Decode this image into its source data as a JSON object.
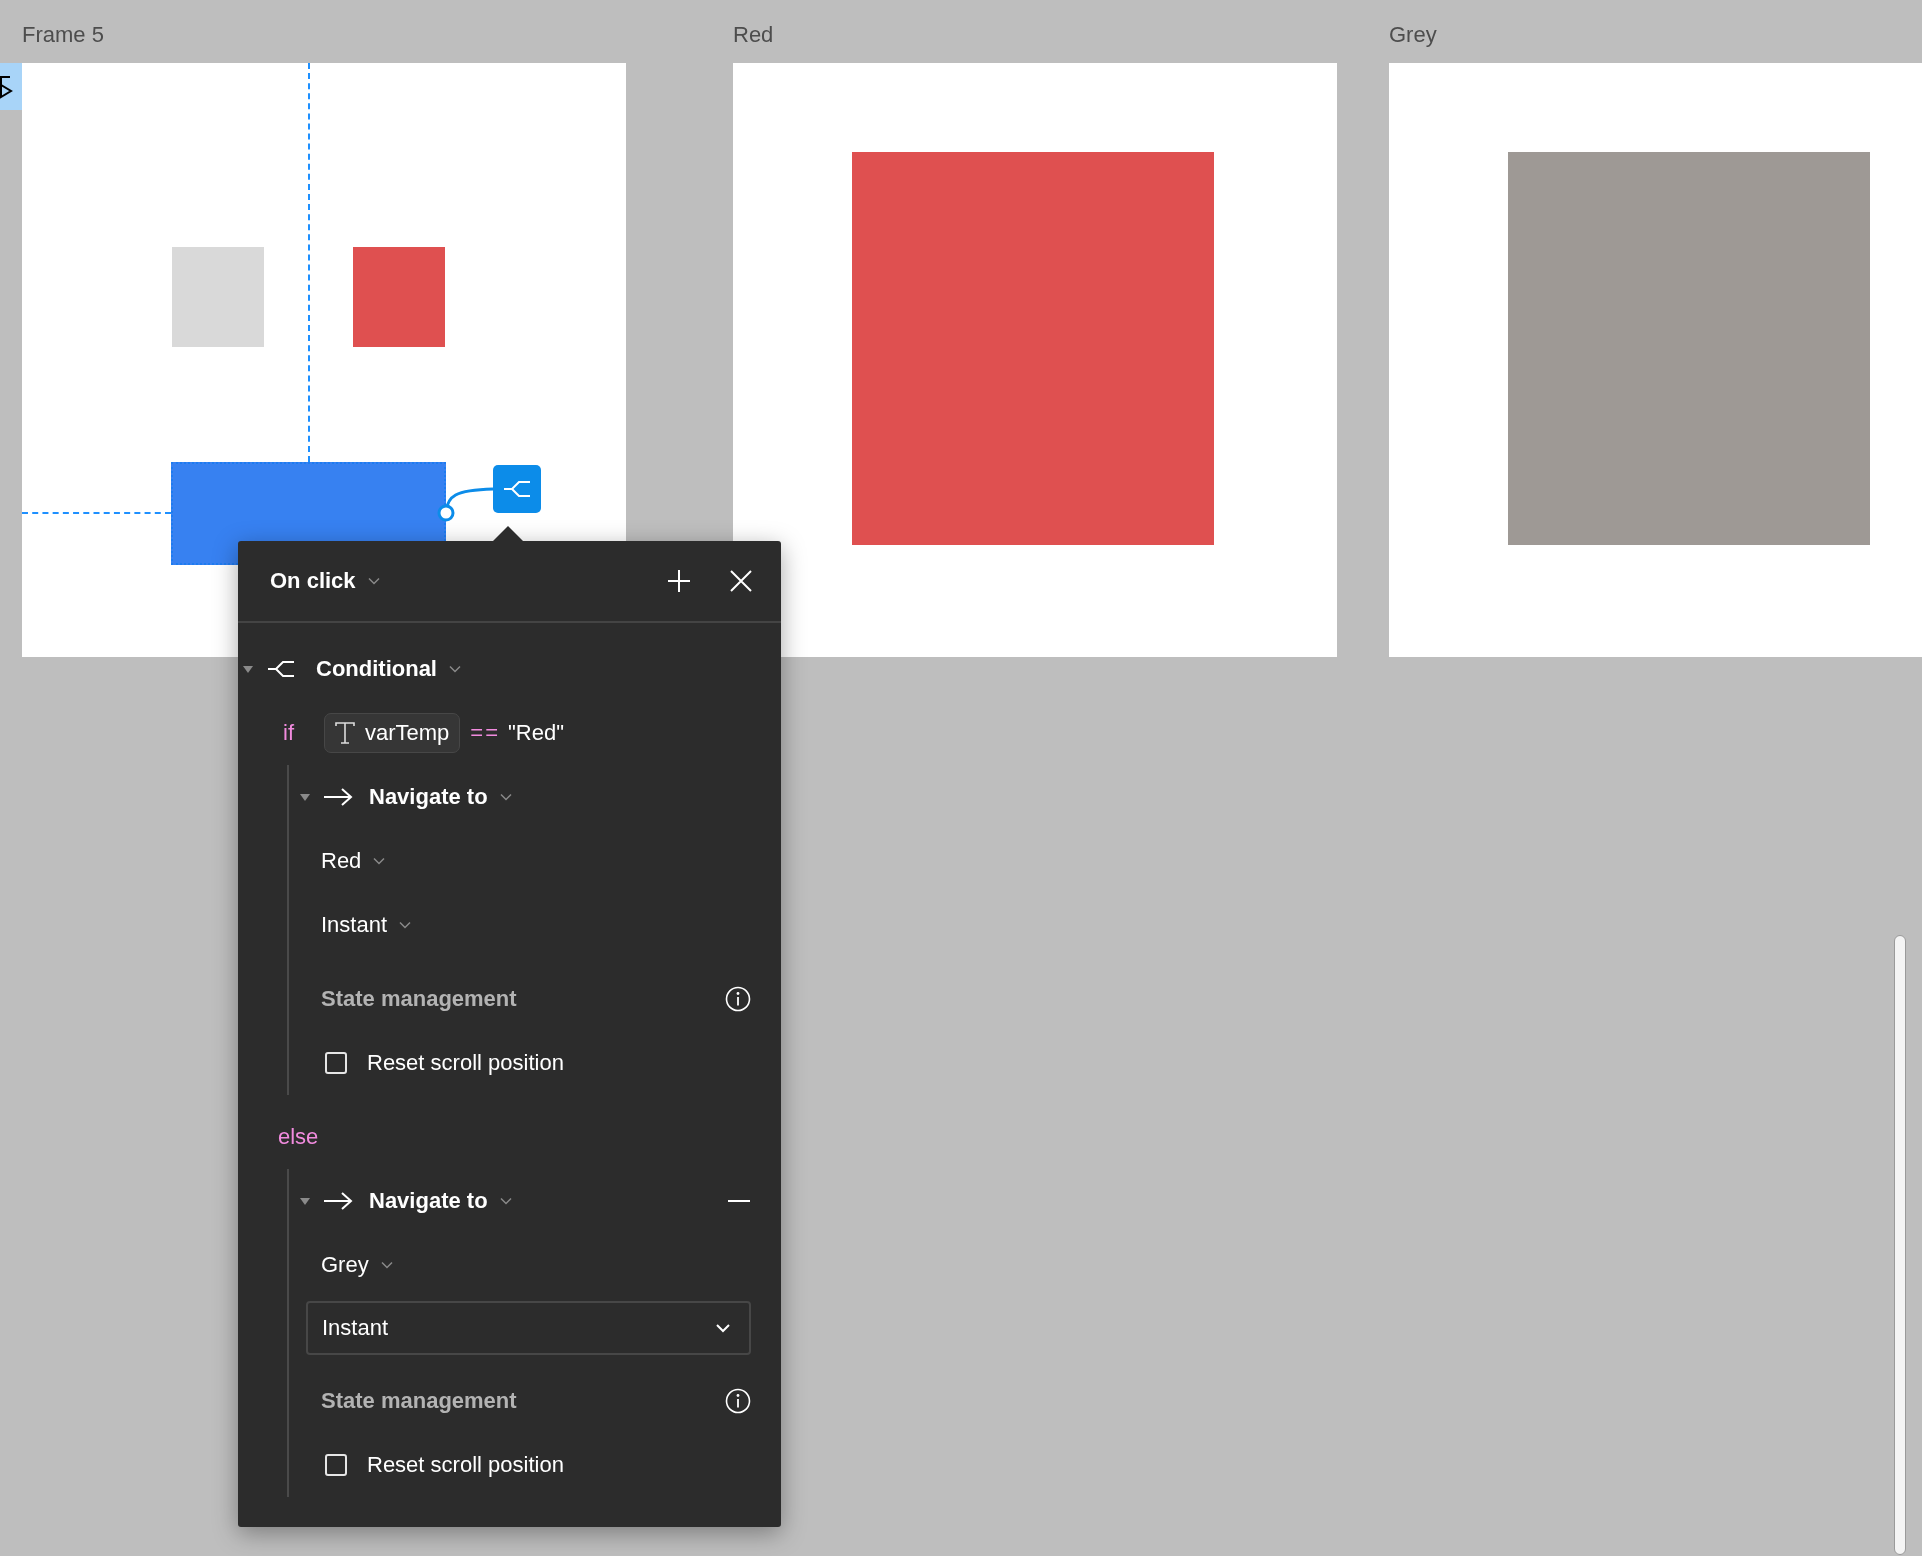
{
  "canvas": {
    "frames": [
      {
        "title": "Frame 5",
        "kind": "layout"
      },
      {
        "title": "Red",
        "kind": "fill",
        "color": "#df5050"
      },
      {
        "title": "Grey",
        "kind": "fill",
        "color": "#9e9995"
      }
    ]
  },
  "interaction_panel": {
    "trigger": "On click",
    "action": {
      "label": "Conditional",
      "expanded": true,
      "branches": [
        {
          "keyword": "if",
          "variable": "varTemp",
          "operator": "==",
          "value": "\"Red\"",
          "action": {
            "label": "Navigate to",
            "expanded": true,
            "removable": false,
            "destination": "Red",
            "animation": {
              "value": "Instant",
              "kind": "inline"
            },
            "state_heading": "State management",
            "options": [
              {
                "label": "Reset scroll position",
                "checked": false
              }
            ]
          }
        },
        {
          "keyword": "else",
          "action": {
            "label": "Navigate to",
            "expanded": true,
            "removable": true,
            "destination": "Grey",
            "animation": {
              "value": "Instant",
              "kind": "dropdown"
            },
            "state_heading": "State management",
            "options": [
              {
                "label": "Reset scroll position",
                "checked": false
              }
            ]
          }
        }
      ]
    }
  }
}
